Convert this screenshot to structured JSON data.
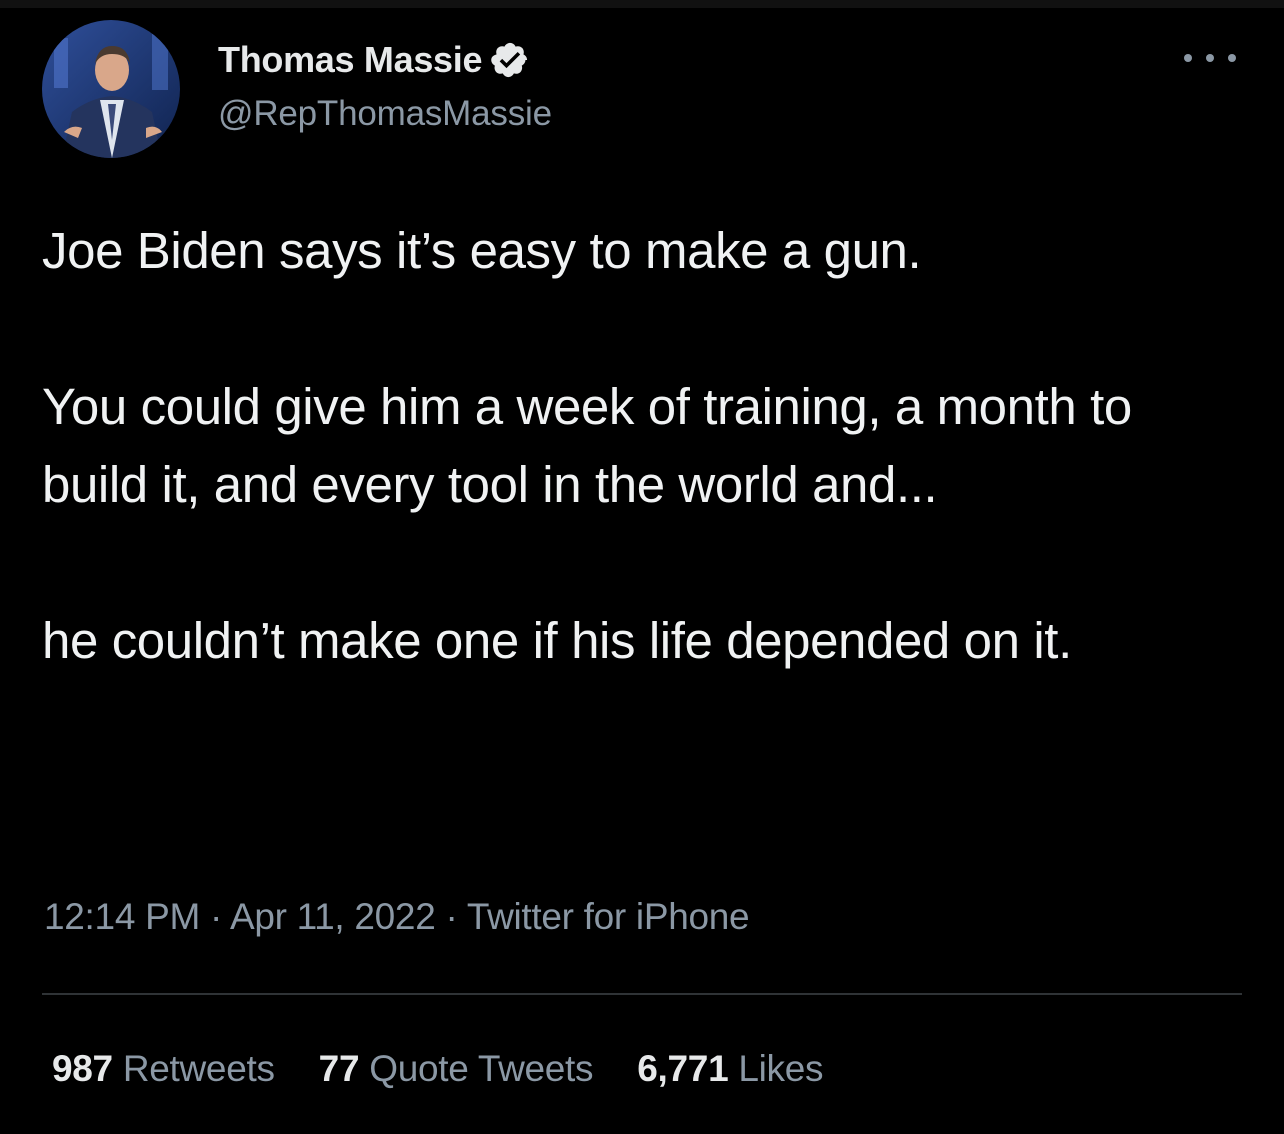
{
  "tweet": {
    "author_name": "Thomas Massie",
    "author_handle": "@RepThomasMassie",
    "paragraphs": [
      "Joe Biden says it’s easy to make a gun.",
      "You could give him a week of training, a month to build it, and every tool in the world and...",
      "he couldn’t make one if his life depended on it."
    ],
    "time": "12:14 PM",
    "date": "Apr 11, 2022",
    "source": "Twitter for iPhone",
    "separator": "·"
  },
  "stats": {
    "retweets_count": "987",
    "retweets_label": "Retweets",
    "quotes_count": "77",
    "quotes_label": "Quote Tweets",
    "likes_count": "6,771",
    "likes_label": "Likes"
  },
  "colors": {
    "background": "#000000",
    "text_primary": "#e7e9ea",
    "text_secondary": "#8b98a5",
    "divider": "#2f3336"
  },
  "icons": {
    "verified": "verified-badge-icon",
    "more": "more-options-icon"
  }
}
